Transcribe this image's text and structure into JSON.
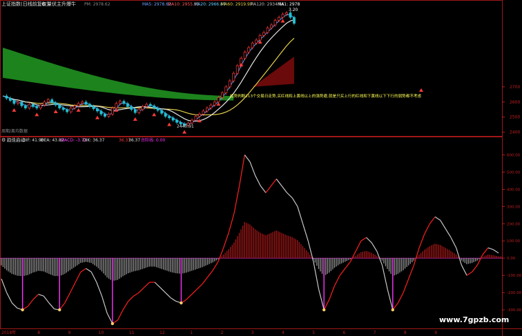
{
  "top_header": {
    "index_name": "上证指数(日线前复权)",
    "indicator_name": "量伏主升爆牛",
    "pm_label": "PM: 2978.62",
    "ma_items": [
      {
        "label": "MA5: 2978.62",
        "color": "#6aa0ff"
      },
      {
        "label": "MA10: 2955.81",
        "color": "#ff5a5a"
      },
      {
        "label": "MA20: 2966.87",
        "color": "#66ccff"
      },
      {
        "label": "MA60: 2919.97",
        "color": "#e6d04a"
      },
      {
        "label": "MA120: 2934.56",
        "color": "#bbbbbb"
      },
      {
        "label": "MA1: 2978",
        "color": "#ffffff"
      }
    ],
    "price_marker": "3.20"
  },
  "annotation_text": "趋势判断213个交易日走势,买红线和上黄线以上的强势避,就是只买上行的红线和下黄线以下下行的弱势都不考虑",
  "watermark_small": "周期/离均数据",
  "low_label": "2440.91",
  "bottom_header": {
    "name": "趋佳启动",
    "dif": "DIF: 41.96",
    "dea": "DEA: 43.82",
    "macd": "MACD: -3.73",
    "dik": "DIK: 36.37",
    "extra1": "36.37",
    "extra2": "36.37",
    "extra3": "台阶线: 0.00"
  },
  "watermark": "www.7gpzb.com",
  "colors": {
    "up": "#ff3b3b",
    "down": "#22c0d0",
    "ma_blue": "#4fa0ff",
    "ma_white": "#e8e8e8",
    "ma_yellow": "#e6d04a",
    "band_green": "#1f8a1f",
    "band_dark_red": "#6a0a0a",
    "osc_red": "#ff2020",
    "osc_white": "#c8c8c8",
    "hist_red": "#b01818",
    "hist_grey": "#9a9a9a",
    "spike": "#ff33ff",
    "dot": "#ffcc66",
    "axis": "#c02020"
  },
  "chart_data": [
    {
      "type": "candlestick",
      "title": "上证指数(日线前复权)",
      "y_ticks": [
        "2700",
        "2600",
        "2500",
        "2400"
      ],
      "ylim": [
        2380,
        3220
      ],
      "low_point": 2440.91,
      "close_approx": [
        2640,
        2625,
        2610,
        2590,
        2600,
        2575,
        2560,
        2585,
        2570,
        2560,
        2580,
        2600,
        2615,
        2595,
        2580,
        2560,
        2550,
        2535,
        2560,
        2575,
        2590,
        2600,
        2585,
        2570,
        2555,
        2540,
        2520,
        2505,
        2520,
        2560,
        2590,
        2605,
        2590,
        2570,
        2550,
        2530,
        2550,
        2570,
        2585,
        2575,
        2560,
        2545,
        2525,
        2505,
        2495,
        2480,
        2465,
        2455,
        2445,
        2460,
        2480,
        2505,
        2520,
        2540,
        2560,
        2580,
        2600,
        2630,
        2660,
        2700,
        2740,
        2790,
        2840,
        2890,
        2930,
        2960,
        2990,
        3010,
        3040,
        3060,
        3090,
        3110,
        3140,
        3160,
        3180,
        3190,
        3160,
        3120
      ]
    },
    {
      "type": "line+bar",
      "title": "趋佳启动",
      "y_ticks": [
        "600.00",
        "500.00",
        "400.00",
        "300.00",
        "200.00",
        "100.00",
        "0.00",
        "-100.00",
        "-200.00",
        "-300.00"
      ],
      "ylim": [
        -400,
        650
      ],
      "x_tick_labels": [
        "2018年",
        "8",
        "9",
        "10",
        "11",
        "12",
        "1",
        "2",
        "3",
        "4",
        "5",
        "6",
        "7",
        "8",
        "9"
      ],
      "red_line": [
        -120,
        -200,
        -260,
        -290,
        -300,
        -280,
        -240,
        -210,
        -220,
        -260,
        -295,
        -300,
        -260,
        -200,
        -140,
        -80,
        -60,
        -80,
        -140,
        -220,
        -320,
        -380,
        -360,
        -300,
        -250,
        -220,
        -200,
        -170,
        -140,
        -140,
        -170,
        -200,
        -230,
        -250,
        -260,
        -240,
        -210,
        -180,
        -150,
        -110,
        -70,
        -20,
        60,
        150,
        260,
        420,
        600,
        560,
        480,
        420,
        380,
        420,
        460,
        420,
        380,
        350,
        300,
        200,
        100,
        -20,
        -180,
        -300,
        -240,
        -160,
        -100,
        -60,
        -20,
        40,
        100,
        120,
        90,
        40,
        -40,
        -180,
        -300,
        -260,
        -200,
        -120,
        -40,
        60,
        140,
        200,
        240,
        220,
        170,
        120,
        60,
        -40,
        -100,
        -80,
        -40,
        20,
        60,
        50,
        30
      ]
    }
  ]
}
